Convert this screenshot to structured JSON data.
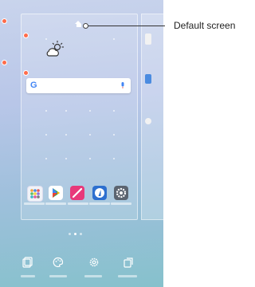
{
  "callout": {
    "label": "Default screen"
  },
  "search_bar": {
    "logo": "G"
  },
  "icons": {
    "home": "home-icon",
    "weather": "weather-icon",
    "mic": "mic-icon",
    "apps": [
      "app-grid-icon",
      "play-store-icon",
      "pen-app-icon",
      "compass-app-icon",
      "settings-app-icon"
    ],
    "toolbar": [
      "widgets-icon",
      "wallpaper-icon",
      "settings-icon",
      "page-icon"
    ]
  },
  "colors": {
    "accent_remove": "#ff6b4a",
    "wallpaper_top": "#c9d4ec",
    "wallpaper_bottom": "#86c1cc"
  }
}
